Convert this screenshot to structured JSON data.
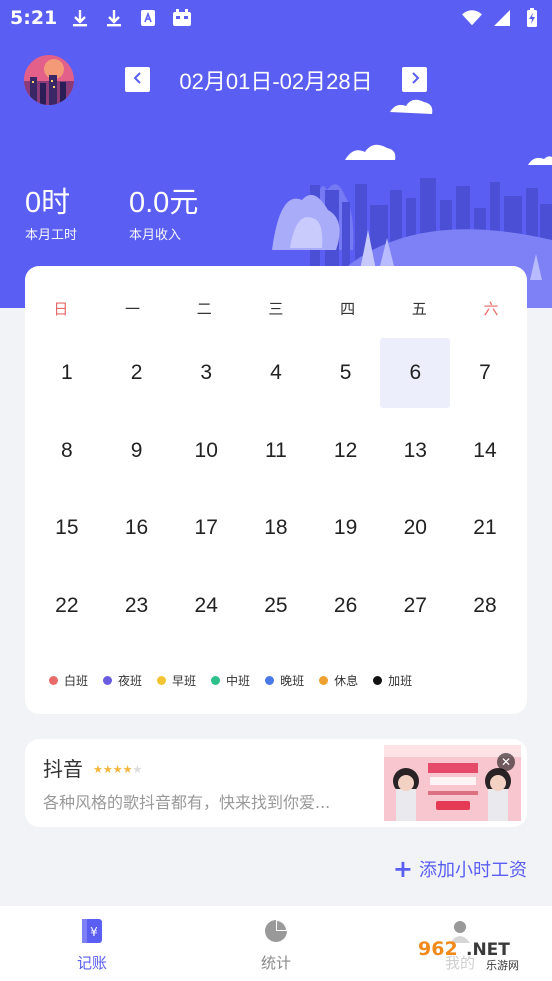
{
  "status_bar": {
    "time": "5:21"
  },
  "header": {
    "date_range": "02月01日-02月28日",
    "stats": [
      {
        "value": "0时",
        "label": "本月工时"
      },
      {
        "value": "0.0元",
        "label": "本月收入"
      }
    ],
    "colors": {
      "primary": "#5a5ef2"
    }
  },
  "calendar": {
    "weekdays": [
      "日",
      "一",
      "二",
      "三",
      "四",
      "五",
      "六"
    ],
    "weeks": [
      [
        "1",
        "2",
        "3",
        "4",
        "5",
        "6",
        "7"
      ],
      [
        "8",
        "9",
        "10",
        "11",
        "12",
        "13",
        "14"
      ],
      [
        "15",
        "16",
        "17",
        "18",
        "19",
        "20",
        "21"
      ],
      [
        "22",
        "23",
        "24",
        "25",
        "26",
        "27",
        "28"
      ]
    ],
    "selected_day": "6",
    "legend": [
      {
        "label": "白班",
        "color": "#e96a6a"
      },
      {
        "label": "夜班",
        "color": "#6b5ce0"
      },
      {
        "label": "早班",
        "color": "#f3c431"
      },
      {
        "label": "中班",
        "color": "#2cc08a"
      },
      {
        "label": "晚班",
        "color": "#4a78e8"
      },
      {
        "label": "休息",
        "color": "#f0a030"
      },
      {
        "label": "加班",
        "color": "#111111"
      }
    ]
  },
  "ad": {
    "title": "抖音",
    "rating": 4,
    "description": "各种风格的歌抖音都有，快来找到你爱..."
  },
  "actions": {
    "add_hourly_label": "添加小时工资"
  },
  "bottom_nav": {
    "tabs": [
      {
        "label": "记账",
        "icon": "ledger-icon",
        "active": true
      },
      {
        "label": "统计",
        "icon": "pie-chart-icon",
        "active": false
      },
      {
        "label": "我的",
        "icon": "profile-icon",
        "active": false
      }
    ]
  },
  "watermark": {
    "text": "962.NET",
    "subtext": "乐游网"
  }
}
